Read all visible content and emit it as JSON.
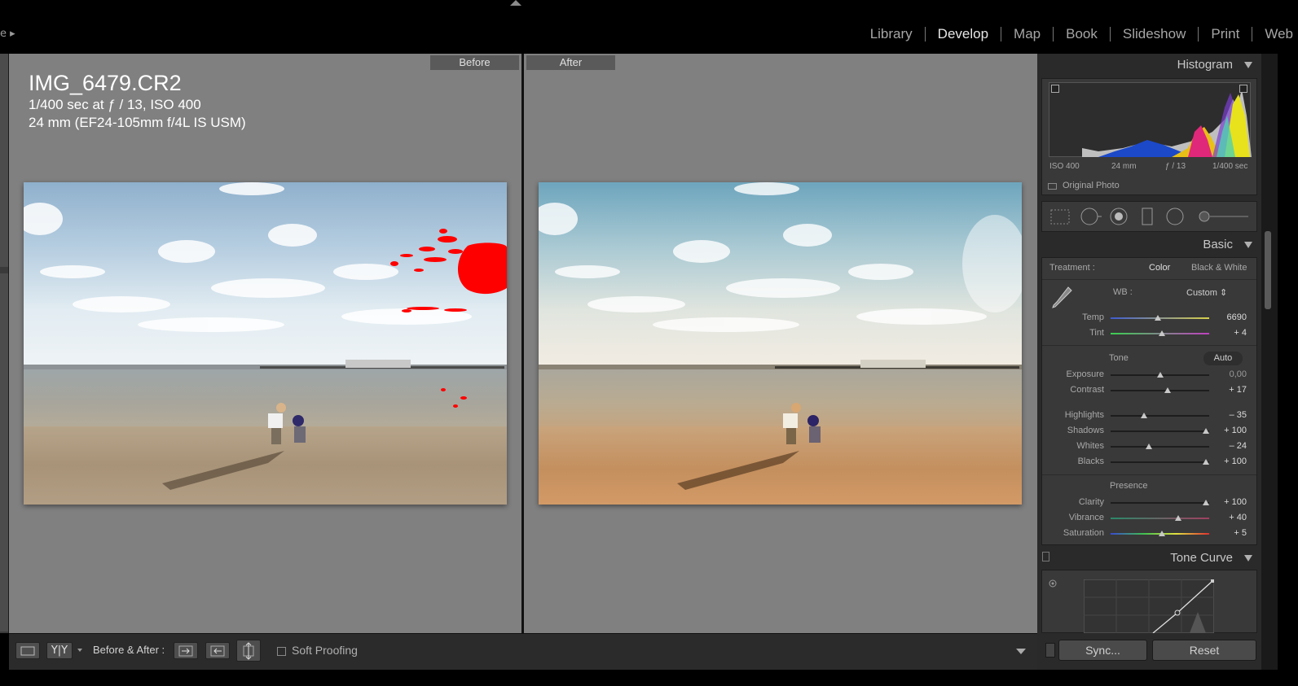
{
  "topbar": {
    "left_fragment": "e ▸",
    "modules": [
      "Library",
      "Develop",
      "Map",
      "Book",
      "Slideshow",
      "Print",
      "Web"
    ],
    "active_module": "Develop"
  },
  "view": {
    "before_label": "Before",
    "after_label": "After",
    "filename": "IMG_6479.CR2",
    "exposure_line": "1/400 sec at ƒ / 13, ISO 400",
    "lens_line": "24 mm (EF24-105mm f/4L IS USM)"
  },
  "toolbar": {
    "before_after_label": "Before & After :",
    "yy_label": "Y|Y",
    "soft_proofing_label": "Soft Proofing",
    "soft_proofing_checked": false
  },
  "histogram": {
    "title": "Histogram",
    "iso": "ISO 400",
    "focal": "24 mm",
    "aperture": "ƒ / 13",
    "shutter": "1/400 sec",
    "original_photo_label": "Original Photo",
    "original_photo_checked": false
  },
  "basic": {
    "title": "Basic",
    "treatment_label": "Treatment :",
    "treatment_color": "Color",
    "treatment_bw": "Black & White",
    "wb_label": "WB :",
    "wb_value": "Custom ⇕",
    "tone_label": "Tone",
    "auto_label": "Auto",
    "presence_label": "Presence",
    "sliders": {
      "temp": {
        "label": "Temp",
        "value": "6690",
        "position": 0.48
      },
      "tint": {
        "label": "Tint",
        "value": "+ 4",
        "position": 0.52
      },
      "exposure": {
        "label": "Exposure",
        "value": "0,00",
        "position": 0.5
      },
      "contrast": {
        "label": "Contrast",
        "value": "+ 17",
        "position": 0.58
      },
      "highlights": {
        "label": "Highlights",
        "value": "– 35",
        "position": 0.34
      },
      "shadows": {
        "label": "Shadows",
        "value": "+ 100",
        "position": 0.97
      },
      "whites": {
        "label": "Whites",
        "value": "– 24",
        "position": 0.39
      },
      "blacks": {
        "label": "Blacks",
        "value": "+ 100",
        "position": 0.97
      },
      "clarity": {
        "label": "Clarity",
        "value": "+ 100",
        "position": 0.97
      },
      "vibrance": {
        "label": "Vibrance",
        "value": "+ 40",
        "position": 0.69
      },
      "saturation": {
        "label": "Saturation",
        "value": "+ 5",
        "position": 0.52
      }
    }
  },
  "tone_curve": {
    "title": "Tone Curve"
  },
  "footer_buttons": {
    "sync": "Sync...",
    "reset": "Reset"
  },
  "colors": {
    "clip_warning": "#ff0000",
    "panel_bg": "#393939",
    "canvas_bg": "#808080"
  }
}
